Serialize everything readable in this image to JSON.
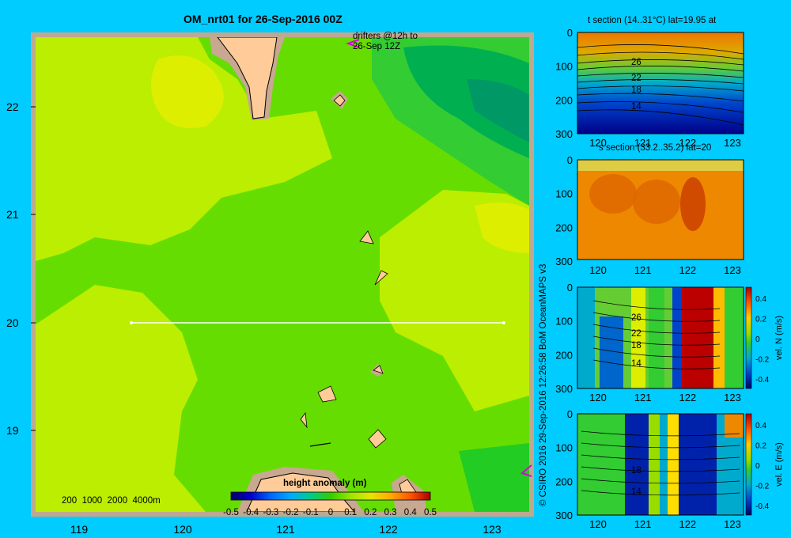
{
  "map": {
    "title": "OM_nrt01 for 26-Sep-2016 00Z",
    "drifters_note": [
      "drifters @12h to",
      "26-Sep 12Z"
    ],
    "depth_legend": "200  1000  2000  4000m",
    "lat_ticks": [
      "22",
      "21",
      "20",
      "19"
    ],
    "lon_ticks": [
      "119",
      "120",
      "121",
      "122",
      "123"
    ],
    "colorbar": {
      "label": "height anomaly  (m)",
      "ticks": [
        "-0.5",
        "-0.4",
        "-0.3",
        "-0.2",
        "-0.1",
        "0",
        "0.1",
        "0.2",
        "0.3",
        "0.4",
        "0.5"
      ]
    },
    "section_line_lat": 20,
    "section_line_lon_range": [
      119.5,
      123.2
    ]
  },
  "copyright": "© CSIRO 2016   29-Sep-2016 12:26:58 BoM OceanMAPS v3",
  "panels": [
    {
      "id": "t",
      "title": "t section (14..31°C) lat=19.95 at",
      "y_ticks": [
        "0",
        "100",
        "200",
        "300"
      ],
      "x_ticks": [
        "120",
        "121",
        "122",
        "123"
      ],
      "contour_labels": [
        "26",
        "22",
        "18",
        "14"
      ]
    },
    {
      "id": "s",
      "title": "s section (33.2..35.2) lat=20",
      "y_ticks": [
        "0",
        "100",
        "200",
        "300"
      ],
      "x_ticks": [
        "120",
        "121",
        "122",
        "123"
      ]
    },
    {
      "id": "vn",
      "title": "",
      "y_ticks": [
        "0",
        "100",
        "200",
        "300"
      ],
      "x_ticks": [
        "120",
        "121",
        "122",
        "123"
      ],
      "contour_labels": [
        "26",
        "22",
        "18",
        "14"
      ],
      "colorbar_label": "vel. N (m/s)",
      "colorbar_ticks": [
        "0.4",
        "0.2",
        "0",
        "-0.2",
        "-0.4"
      ]
    },
    {
      "id": "ve",
      "title": "",
      "y_ticks": [
        "0",
        "100",
        "200",
        "300"
      ],
      "x_ticks": [
        "120",
        "121",
        "122",
        "123"
      ],
      "contour_labels": [
        "18",
        "14"
      ],
      "colorbar_label": "vel. E (m/s)",
      "colorbar_ticks": [
        "0.4",
        "0.2",
        "0",
        "-0.2",
        "-0.4"
      ]
    }
  ],
  "colors": {
    "background": "#00ccff",
    "land": "#ffcc99",
    "shelf": "#c8a890",
    "field_base": "#66dd00",
    "field_high": "#ccf000",
    "field_low": "#00b050",
    "section_line": "#ffffff",
    "drifter": "#dd00dd"
  }
}
